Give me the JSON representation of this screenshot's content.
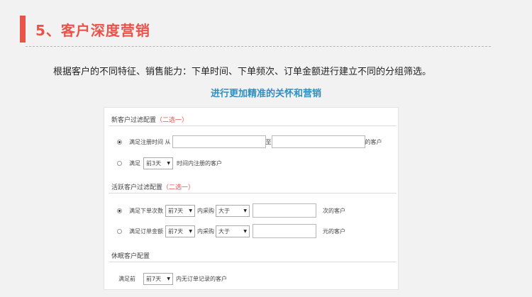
{
  "header": {
    "title": "5、客户深度营销"
  },
  "intro": "根据客户的不同特征、销售能力：下单时间、下单频次、订单金额进行建立不同的分组筛选。",
  "subtitle": "进行更加精准的关怀和营销",
  "colors": {
    "accent": "#e8534a",
    "subtitle": "#2e8fc1"
  },
  "new_customer": {
    "title": "新客户过滤配置",
    "note": "（二选一）",
    "row1": {
      "prefix": "满足注册时间 从",
      "mid": "至",
      "suffix": "的客户",
      "from_value": "",
      "to_value": ""
    },
    "row2": {
      "prefix": "满足",
      "select": "前3天",
      "suffix": "时间内注册的客户"
    }
  },
  "active_customer": {
    "title": "活跃客户过滤配置",
    "note": "（二选一）",
    "row1": {
      "prefix": "满足下单次数",
      "select1": "前7天",
      "mid": "内采购",
      "select2": "大于",
      "value": "",
      "suffix": "次的客户"
    },
    "row2": {
      "prefix": "满足订单金额",
      "select1": "前7天",
      "mid": "内采购",
      "select2": "大于",
      "value": "",
      "suffix": "元的客户"
    }
  },
  "dormant_customer": {
    "title": "休眠客户配置",
    "row1": {
      "prefix": "满足前",
      "select": "前7天",
      "suffix": "内无订单记录的客户"
    }
  }
}
